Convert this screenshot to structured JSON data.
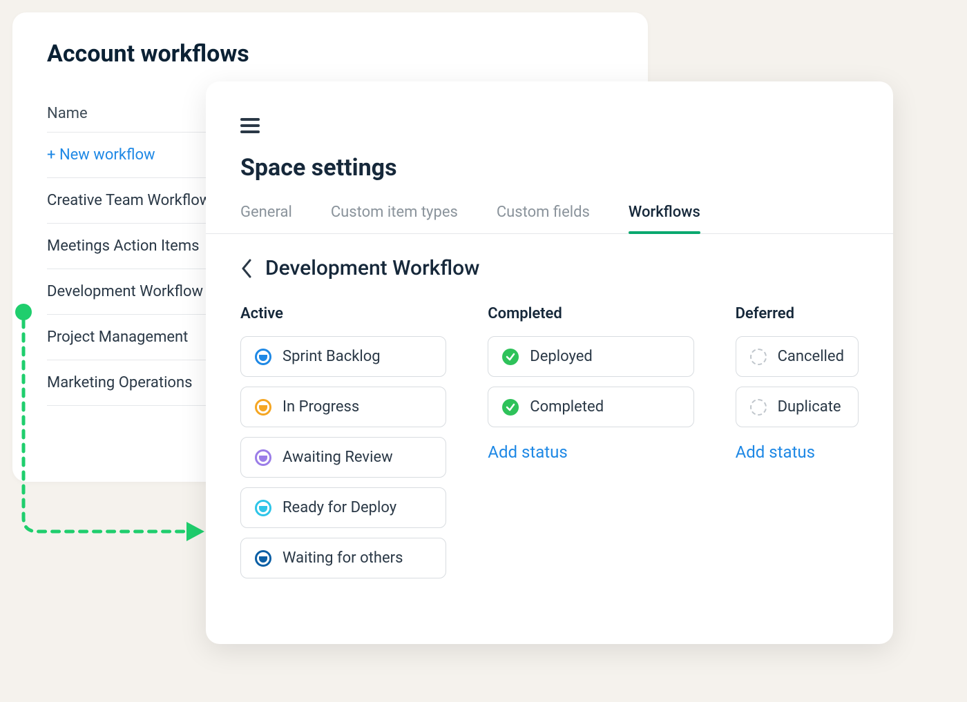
{
  "leftPanel": {
    "title": "Account workflows",
    "nameHeader": "Name",
    "newWorkflow": "+ New workflow",
    "rows": [
      "Creative Team Workflow",
      "Meetings Action Items",
      "Development Workflow",
      "Project Management",
      "Marketing Operations"
    ]
  },
  "rightPanel": {
    "title": "Space settings",
    "tabs": {
      "general": "General",
      "customItemTypes": "Custom item types",
      "customFields": "Custom fields",
      "workflows": "Workflows"
    },
    "breadcrumbName": "Development Workflow",
    "columns": {
      "active": {
        "header": "Active",
        "items": [
          {
            "label": "Sprint Backlog",
            "icon": "blue"
          },
          {
            "label": "In Progress",
            "icon": "orange"
          },
          {
            "label": "Awaiting Review",
            "icon": "purple"
          },
          {
            "label": "Ready for Deploy",
            "icon": "cyan"
          },
          {
            "label": "Waiting for others",
            "icon": "dblue"
          }
        ]
      },
      "completed": {
        "header": "Completed",
        "items": [
          {
            "label": "Deployed"
          },
          {
            "label": "Completed"
          }
        ],
        "addLabel": "Add status"
      },
      "deferred": {
        "header": "Deferred",
        "items": [
          {
            "label": "Cancelled"
          },
          {
            "label": "Duplicate"
          }
        ],
        "addLabel": "Add status"
      }
    }
  }
}
